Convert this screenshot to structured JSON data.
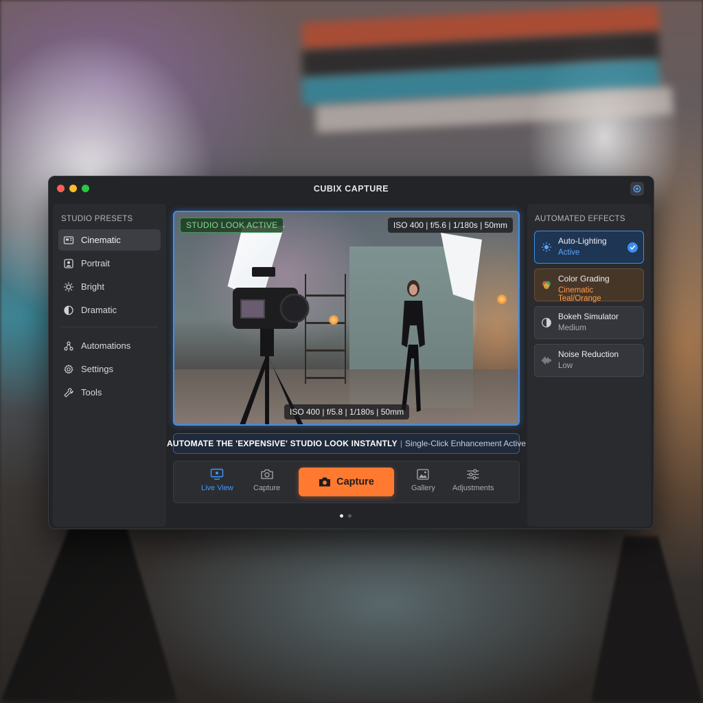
{
  "window": {
    "title": "CUBIX CAPTURE"
  },
  "sidebar": {
    "presets_title": "STUDIO PRESETS",
    "presets": [
      {
        "label": "Cinematic",
        "icon": "film-icon"
      },
      {
        "label": "Portrait",
        "icon": "portrait-icon"
      },
      {
        "label": "Bright",
        "icon": "sun-icon"
      },
      {
        "label": "Dramatic",
        "icon": "contrast-icon"
      }
    ],
    "active_preset": "Cinematic",
    "tools": [
      {
        "label": "Automations",
        "icon": "nodes-icon"
      },
      {
        "label": "Settings",
        "icon": "gear-icon"
      },
      {
        "label": "Tools",
        "icon": "wrench-icon"
      }
    ]
  },
  "preview": {
    "status_badge": "STUDIO LOOK ACTIVE",
    "exposure_top": "ISO 400 | f/5.6 | 1/180s | 50mm",
    "exposure_bottom": "ISO 400 | f/5.8 | 1/180s | 50mm"
  },
  "banner": {
    "headline": "AUTOMATE THE 'EXPENSIVE' STUDIO LOOK INSTANTLY",
    "separator": "|",
    "subtext": "Single-Click Enhancement Active"
  },
  "toolbar": {
    "live_view": "Live View",
    "capture_tab": "Capture",
    "capture_button": "Capture",
    "gallery": "Gallery",
    "adjustments": "Adjustments",
    "pages": 2,
    "current_page": 1
  },
  "effects": {
    "title": "AUTOMATED EFFECTS",
    "items": [
      {
        "name": "Auto-Lighting",
        "value": "Active",
        "icon": "light-icon",
        "state": "active"
      },
      {
        "name": "Color Grading",
        "value": "Cinematic Teal/Orange",
        "icon": "color-wheel-icon",
        "state": "warm"
      },
      {
        "name": "Bokeh Simulator",
        "value": "Medium",
        "icon": "bokeh-icon",
        "state": "normal"
      },
      {
        "name": "Noise Reduction",
        "value": "Low",
        "icon": "waveform-icon",
        "state": "normal"
      }
    ]
  },
  "colors": {
    "accent_blue": "#3d8ef2",
    "accent_orange": "#ff7a30",
    "status_green": "#7ee08b"
  }
}
